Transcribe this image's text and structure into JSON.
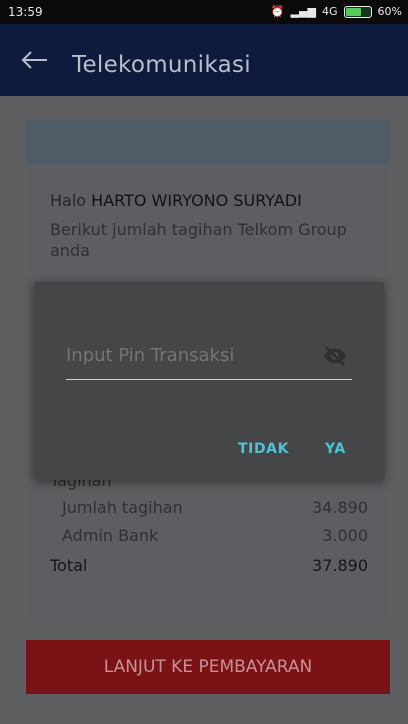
{
  "status_bar": {
    "time": "13:59",
    "network": "4G",
    "battery": "60%"
  },
  "appbar": {
    "title": "Telekomunikasi"
  },
  "greeting": {
    "prefix": "Halo",
    "name": "HARTO WIRYONO SURYADI",
    "subtitle": "Berikut jumlah tagihan Telkom Group anda"
  },
  "bill": {
    "section_label": "Tagihan",
    "rows": [
      {
        "label": "Jumlah tagihan",
        "value": "34.890"
      },
      {
        "label": "Admin Bank",
        "value": "3.000"
      }
    ],
    "total": {
      "label": "Total",
      "value": "37.890"
    }
  },
  "dialog": {
    "placeholder": "Input Pin Transaksi",
    "cancel_label": "TIDAK",
    "confirm_label": "YA"
  },
  "pay_button": {
    "label": "LANJUT KE PEMBAYARAN"
  },
  "colors": {
    "appbar": "#0e1b3c",
    "accent": "#4fc3da",
    "pay_button": "#7a1216"
  }
}
